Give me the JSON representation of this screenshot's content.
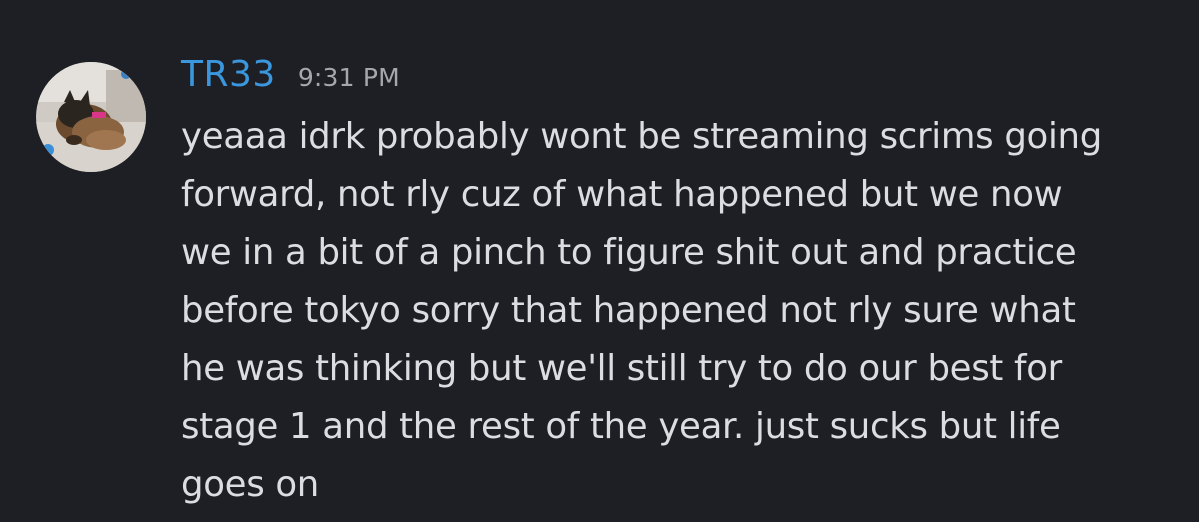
{
  "message": {
    "author": "TR33",
    "timestamp": "9:31 PM",
    "content_lines": [
      "yeaaa idrk probably wont be streaming scrims going",
      "forward, not rly cuz of what happened but we now",
      "we in a bit of a pinch to figure shit out and practice",
      "before tokyo sorry that happened not rly sure what",
      "he was thinking but we'll still try to do our best for",
      "stage 1 and the rest of the year. just sucks but life",
      "goes on"
    ]
  },
  "colors": {
    "background": "#1e1f24",
    "author_name": "#3a96dd",
    "timestamp": "#a5a7ad",
    "message_text": "#dcdde1"
  },
  "icons": {
    "avatar": "user-avatar-dog-photo"
  }
}
